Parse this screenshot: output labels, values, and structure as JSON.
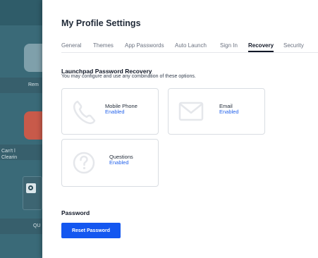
{
  "background_app": {
    "labels": [
      "Rem",
      "Can't l",
      "Clearin",
      "QU"
    ]
  },
  "panel": {
    "title": "My Profile Settings",
    "tabs": [
      {
        "label": "General",
        "active": false
      },
      {
        "label": "Themes",
        "active": false
      },
      {
        "label": "App Passwords",
        "active": false
      },
      {
        "label": "Auto Launch",
        "active": false
      },
      {
        "label": "Sign In",
        "active": false
      },
      {
        "label": "Recovery",
        "active": true
      },
      {
        "label": "Security",
        "active": false
      }
    ],
    "recovery": {
      "title": "Launchpad Password Recovery",
      "subtitle": "You may configure and use any combination of these options.",
      "options": [
        {
          "label": "Mobile Phone",
          "status": "Enabled",
          "icon": "phone-icon"
        },
        {
          "label": "Email",
          "status": "Enabled",
          "icon": "envelope-icon"
        },
        {
          "label": "Questions",
          "status": "Enabled",
          "icon": "question-icon"
        }
      ]
    },
    "password": {
      "title": "Password",
      "reset_button": "Reset Password"
    },
    "colors": {
      "accent": "#1457f0",
      "status": "#2563eb"
    }
  }
}
